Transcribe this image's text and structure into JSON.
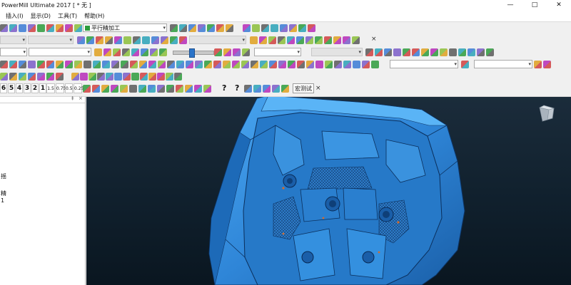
{
  "window": {
    "title": "PowerMill Ultimate 2017  [ * 无 ]",
    "minimize_icon": "minimize-icon",
    "maximize_icon": "maximize-icon",
    "close_icon": "close-icon"
  },
  "menu": [
    "插入(I)",
    "显示(D)",
    "工具(T)",
    "帮助(H)"
  ],
  "toolbar1": {
    "strategy_combo": "平行精加工"
  },
  "toolbar5": {
    "view_numbers": [
      "6",
      "5",
      "4",
      "3",
      "2",
      "1"
    ],
    "scale_buttons": [
      "1.5",
      "0.75",
      "0.5",
      "0.25"
    ],
    "macro_button": "宏测试"
  },
  "help_icons": [
    "help-icon",
    "help-icon"
  ],
  "left_panel": {
    "chars": [
      "摇",
      "精",
      "1"
    ]
  },
  "colors": {
    "part_blue": "#2f86d8",
    "viewport_bg": "#13222f",
    "accent_green": "#2d9c3c",
    "accent_magenta": "#b62ab8"
  }
}
